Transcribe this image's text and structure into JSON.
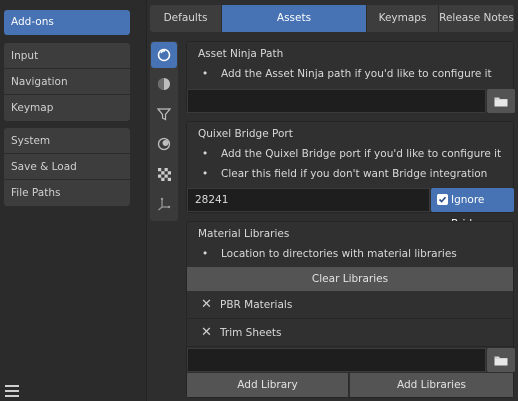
{
  "sidebar": {
    "active_item": "Add-ons",
    "group1": [
      "Input",
      "Navigation",
      "Keymap"
    ],
    "group2": [
      "System",
      "Save & Load",
      "File Paths"
    ],
    "menu_icon": "hamburger-icon"
  },
  "tabs": [
    "Defaults",
    "Assets",
    "Keymaps",
    "Release Notes"
  ],
  "active_tab": "Assets",
  "icon_column": [
    "scene-sphere-icon",
    "material-ball-icon",
    "filter-icon",
    "shading-icon",
    "checker-texture-icon",
    "transform-gizmo-icon"
  ],
  "asset_ninja": {
    "title": "Asset Ninja Path",
    "bullet": "Add the Asset Ninja path if you'd like to configure it",
    "path_value": ""
  },
  "quixel": {
    "title": "Quixel Bridge Port",
    "bullets": [
      "Add the Quixel Bridge port if you'd like to configure it",
      "Clear this field if you don't want Bridge integration"
    ],
    "port_value": "28241",
    "ignore_label": "Ignore Bridge",
    "ignore_checked": true
  },
  "materials": {
    "title": "Material Libraries",
    "bullet": "Location to directories with material libraries",
    "clear_label": "Clear Libraries",
    "libraries": [
      "PBR Materials",
      "Trim Sheets"
    ],
    "new_path_value": "",
    "add_library_label": "Add Library",
    "add_libraries_label": "Add Libraries"
  },
  "colors": {
    "accent": "#4772b3",
    "background": "#2e2e2e",
    "panel": "#303030",
    "button": "#545454",
    "field": "#1e1e1e"
  }
}
